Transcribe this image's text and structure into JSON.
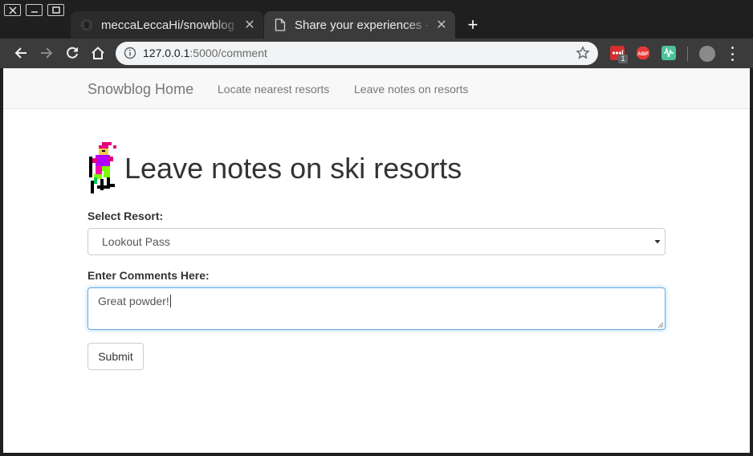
{
  "browser": {
    "tabs": [
      {
        "title": "meccaLeccaHi/snowblog",
        "active": false,
        "icon": "github-icon"
      },
      {
        "title": "Share your experiences - S",
        "active": true,
        "icon": "page-icon"
      }
    ],
    "close_glyph": "✕",
    "new_tab_glyph": "+",
    "url_host": "127.0.0.1",
    "url_path": ":5000/comment",
    "extension_badge": "1",
    "extensions": [
      "lastpass-icon",
      "adblock-icon",
      "extension-icon"
    ]
  },
  "navbar": {
    "brand": "Snowblog Home",
    "links": [
      "Locate nearest resorts",
      "Leave notes on resorts"
    ]
  },
  "main": {
    "title": "Leave notes on ski resorts",
    "resort_label": "Select Resort:",
    "resort_selected": "Lookout Pass",
    "comments_label": "Enter Comments Here:",
    "comments_value": "Great powder!",
    "submit_label": "Submit"
  },
  "colors": {
    "tab_active": "#3b3b3b",
    "focus_border": "#66afe9",
    "navbar_bg": "#f8f8f8"
  }
}
